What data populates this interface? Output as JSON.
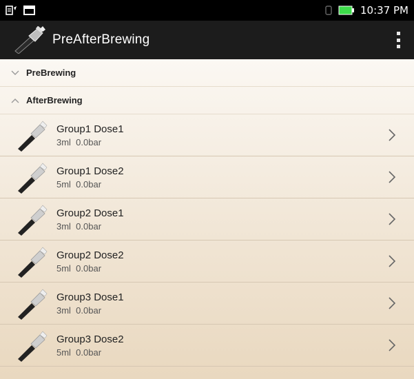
{
  "statusbar": {
    "time": "10:37 PM",
    "icons": [
      "notification-icon",
      "screen-icon",
      "signal-icon",
      "battery-icon"
    ]
  },
  "appbar": {
    "title": "PreAfterBrewing",
    "logo": "portafilter-icon",
    "menu": "overflow-menu-icon"
  },
  "sections": [
    {
      "label": "PreBrewing",
      "expanded": false
    },
    {
      "label": "AfterBrewing",
      "expanded": true
    }
  ],
  "items": [
    {
      "title": "Group1 Dose1",
      "sub": "3ml  0.0bar"
    },
    {
      "title": "Group1 Dose2",
      "sub": "5ml  0.0bar"
    },
    {
      "title": "Group2 Dose1",
      "sub": "3ml  0.0bar"
    },
    {
      "title": "Group2 Dose2",
      "sub": "5ml  0.0bar"
    },
    {
      "title": "Group3 Dose1",
      "sub": "3ml  0.0bar"
    },
    {
      "title": "Group3 Dose2",
      "sub": "5ml  0.0bar"
    }
  ],
  "colors": {
    "statusbar": "#000000",
    "appbar": "#1c1c1c",
    "battery": "#3ddc4a"
  }
}
